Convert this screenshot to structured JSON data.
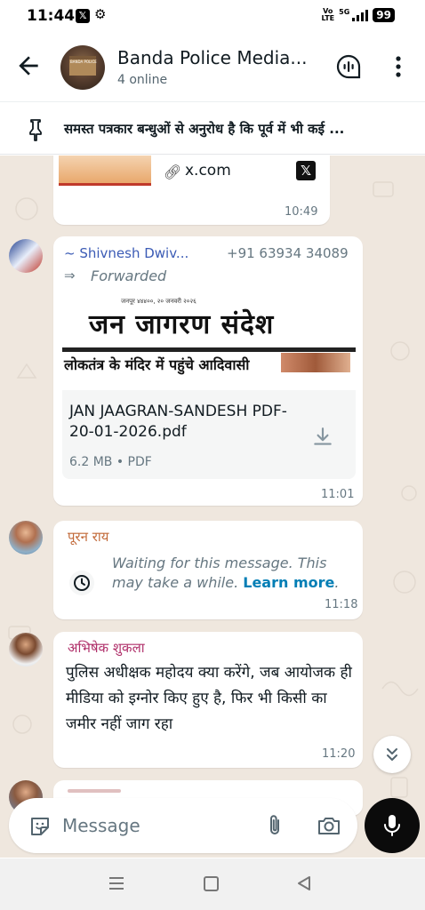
{
  "status": {
    "time": "11:44",
    "volte_top": "Vo",
    "volte_bottom": "LTE",
    "network": "5G",
    "battery": "99"
  },
  "header": {
    "title": "Banda Police Media...",
    "subtitle": "4 online"
  },
  "pinned": {
    "text": "समस्त पत्रकार बन्धुओं से अनुरोध है कि पूर्व में भी कई ..."
  },
  "messages": {
    "link": {
      "domain": "x.com",
      "time": "10:49"
    },
    "doc": {
      "sender": "~ Shivnesh Dwiv...",
      "phone": "+91 63934 34089",
      "forwarded": "Forwarded",
      "newspaper_title": "जन जागरण संदेश",
      "newspaper_headline": "लोकतंत्र के मंदिर में पहुंचे आदिवासी",
      "file_name": "JAN JAAGRAN-SANDESH PDF-20-01-2026.pdf",
      "file_meta": "6.2 MB • PDF",
      "time": "11:01"
    },
    "waiting": {
      "sender": "पूरन राय",
      "text": "Waiting for this message. This may take a while.",
      "link": "Learn more",
      "time": "11:18"
    },
    "text_msg": {
      "sender": "अभिषेक शुकला",
      "body": "पुलिस अधीक्षक महोदय क्या करेंगे, जब आयोजक ही मीडिया को इग्नोर किए हुए है, फिर भी किसी का जमीर नहीं जाग रहा",
      "time": "11:20"
    }
  },
  "input": {
    "placeholder": "Message"
  },
  "colors": {
    "chat_bg": "#efe7de",
    "sender_doc": "#3b5bb5",
    "sender_waiting": "#c26a3a",
    "sender_text": "#b0306a",
    "link_blue": "#027eb5"
  }
}
